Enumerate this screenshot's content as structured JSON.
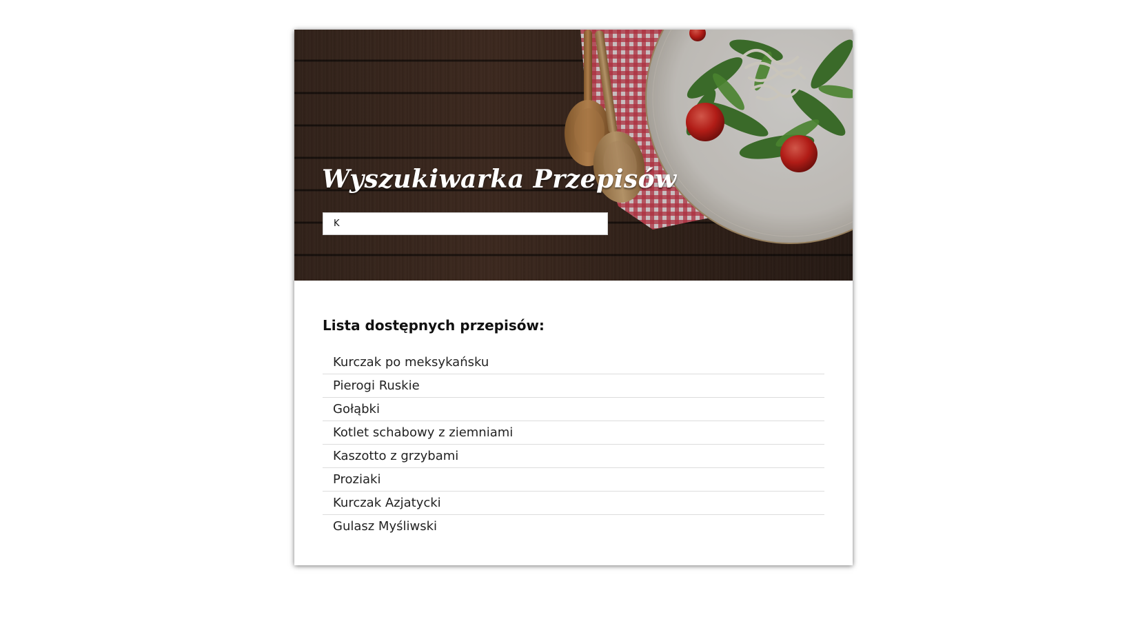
{
  "header": {
    "title": "Wyszukiwarka Przepisów"
  },
  "search": {
    "value": "K",
    "placeholder": ""
  },
  "list": {
    "heading": "Lista dostępnych przepisów:",
    "items": [
      "Kurczak po meksykańsku",
      "Pierogi Ruskie",
      "Gołąbki",
      "Kotlet schabowy z ziemniami",
      "Kaszotto z grzybami",
      "Proziaki",
      "Kurczak Azjatycki",
      "Gulasz Myśliwski"
    ]
  },
  "colors": {
    "wood": "#3d2a20",
    "tablecloth": "#c0283a",
    "text": "#222222"
  },
  "icons": {
    "hero_image": "salad-plate-with-wooden-spoons-image"
  }
}
